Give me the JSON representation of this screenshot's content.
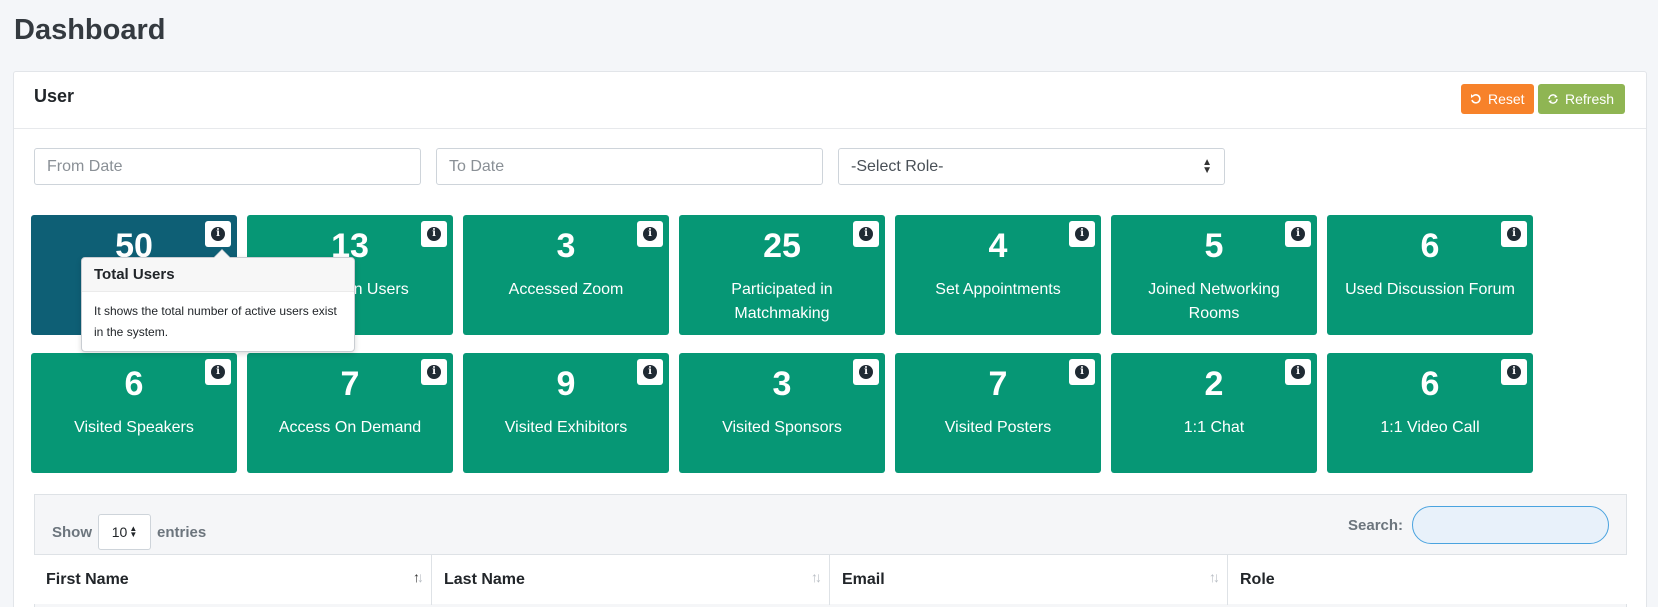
{
  "page": {
    "title": "Dashboard"
  },
  "card": {
    "title": "User",
    "reset_label": "Reset",
    "refresh_label": "Refresh"
  },
  "filters": {
    "from_placeholder": "From Date",
    "to_placeholder": "To Date",
    "role_selected": "-Select Role-"
  },
  "tiles": [
    {
      "value": "50",
      "label": "Total Users"
    },
    {
      "value": "13",
      "label": "Logged In Users"
    },
    {
      "value": "3",
      "label": "Accessed Zoom"
    },
    {
      "value": "25",
      "label": "Participated in Matchmaking"
    },
    {
      "value": "4",
      "label": "Set Appointments"
    },
    {
      "value": "5",
      "label": "Joined Networking Rooms"
    },
    {
      "value": "6",
      "label": "Used Discussion Forum"
    },
    {
      "value": "6",
      "label": "Visited Speakers"
    },
    {
      "value": "7",
      "label": "Access On Demand"
    },
    {
      "value": "9",
      "label": "Visited Exhibitors"
    },
    {
      "value": "3",
      "label": "Visited Sponsors"
    },
    {
      "value": "7",
      "label": "Visited Posters"
    },
    {
      "value": "2",
      "label": "1:1 Chat"
    },
    {
      "value": "6",
      "label": "1:1 Video Call"
    }
  ],
  "tooltip": {
    "title": "Total Users",
    "body": "It shows the total number of active users exist in the system."
  },
  "table": {
    "show_label": "Show",
    "entries_value": "10",
    "entries_label": "entries",
    "search_label": "Search:",
    "columns": [
      "First Name",
      "Last Name",
      "Email",
      "Role"
    ]
  },
  "colors": {
    "tile": "#069775",
    "tile_active": "#0e5f75",
    "reset": "#f7822a",
    "refresh": "#8fb553"
  }
}
